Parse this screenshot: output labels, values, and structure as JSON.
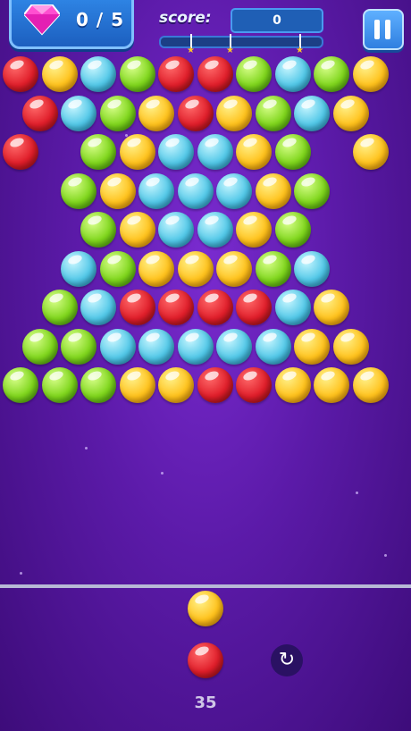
{
  "hud": {
    "gems": "0 / 5",
    "score_label": "score:",
    "score": "0",
    "progress_fraction": 0.0,
    "star_thresholds_fraction": [
      0.19,
      0.43,
      0.86
    ],
    "pause_icon": "pause-icon",
    "gem_icon": "diamond-icon"
  },
  "colors": {
    "R": "#e01e2a",
    "Y": "#ffc21c",
    "B": "#52c8e8",
    "G": "#7fd61c"
  },
  "grid": {
    "rows": [
      [
        "R",
        "Y",
        "B",
        "G",
        "R",
        "R",
        "G",
        "B",
        "G",
        "Y"
      ],
      [
        "R",
        "B",
        "G",
        "Y",
        "R",
        "Y",
        "G",
        "B",
        "Y"
      ],
      [
        "R",
        null,
        "G",
        "Y",
        "B",
        "B",
        "Y",
        "G",
        null,
        "Y"
      ],
      [
        null,
        "G",
        "Y",
        "B",
        "B",
        "B",
        "Y",
        "G"
      ],
      [
        null,
        null,
        "G",
        "Y",
        "B",
        "B",
        "Y",
        "G"
      ],
      [
        null,
        "B",
        "G",
        "Y",
        "Y",
        "Y",
        "G",
        "B"
      ],
      [
        null,
        "G",
        "B",
        "R",
        "R",
        "R",
        "R",
        "B",
        "Y"
      ],
      [
        "G",
        "G",
        "B",
        "B",
        "B",
        "B",
        "B",
        "Y",
        "Y"
      ],
      [
        "G",
        "G",
        "G",
        "Y",
        "Y",
        "R",
        "R",
        "Y",
        "Y",
        "Y"
      ]
    ]
  },
  "shooter": {
    "next_bubble": "Y",
    "current_bubble": "R",
    "shots_left": "35",
    "reload_icon": "reload-icon"
  }
}
